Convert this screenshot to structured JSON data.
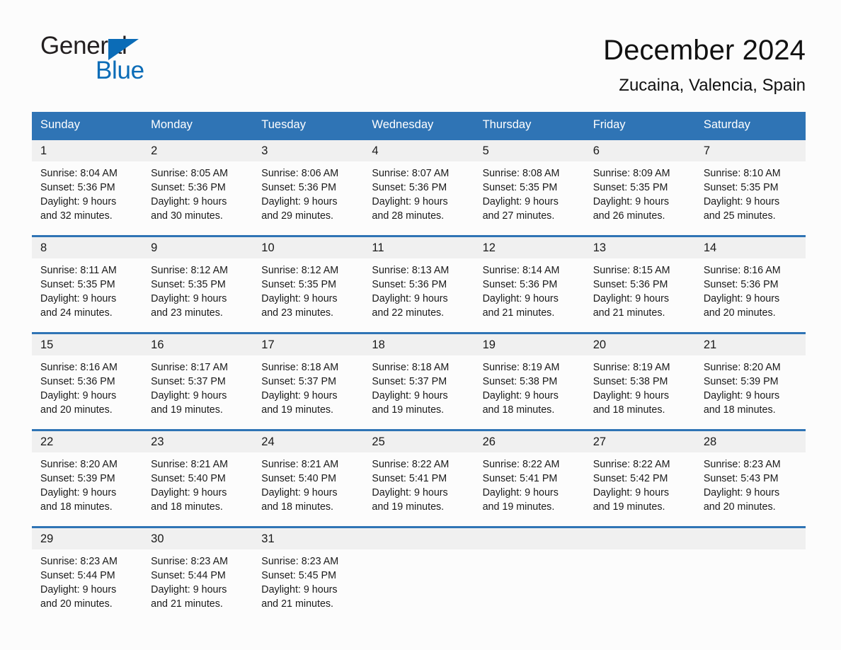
{
  "brand": {
    "name_part1": "General",
    "name_part2": "Blue",
    "triangle_icon": "triangle-icon",
    "accent_color": "#0b6cb7"
  },
  "header": {
    "title": "December 2024",
    "location": "Zucaina, Valencia, Spain"
  },
  "theme": {
    "header_blue": "#2f74b5",
    "daynum_band": "#f0f0f0",
    "page_background": "#fcfcfc",
    "text": "#1a1a1a"
  },
  "calendar": {
    "weekday_headers": [
      "Sunday",
      "Monday",
      "Tuesday",
      "Wednesday",
      "Thursday",
      "Friday",
      "Saturday"
    ],
    "weeks": [
      {
        "days": [
          {
            "num": "1",
            "sunrise": "Sunrise: 8:04 AM",
            "sunset": "Sunset: 5:36 PM",
            "daylight_l1": "Daylight: 9 hours",
            "daylight_l2": "and 32 minutes."
          },
          {
            "num": "2",
            "sunrise": "Sunrise: 8:05 AM",
            "sunset": "Sunset: 5:36 PM",
            "daylight_l1": "Daylight: 9 hours",
            "daylight_l2": "and 30 minutes."
          },
          {
            "num": "3",
            "sunrise": "Sunrise: 8:06 AM",
            "sunset": "Sunset: 5:36 PM",
            "daylight_l1": "Daylight: 9 hours",
            "daylight_l2": "and 29 minutes."
          },
          {
            "num": "4",
            "sunrise": "Sunrise: 8:07 AM",
            "sunset": "Sunset: 5:36 PM",
            "daylight_l1": "Daylight: 9 hours",
            "daylight_l2": "and 28 minutes."
          },
          {
            "num": "5",
            "sunrise": "Sunrise: 8:08 AM",
            "sunset": "Sunset: 5:35 PM",
            "daylight_l1": "Daylight: 9 hours",
            "daylight_l2": "and 27 minutes."
          },
          {
            "num": "6",
            "sunrise": "Sunrise: 8:09 AM",
            "sunset": "Sunset: 5:35 PM",
            "daylight_l1": "Daylight: 9 hours",
            "daylight_l2": "and 26 minutes."
          },
          {
            "num": "7",
            "sunrise": "Sunrise: 8:10 AM",
            "sunset": "Sunset: 5:35 PM",
            "daylight_l1": "Daylight: 9 hours",
            "daylight_l2": "and 25 minutes."
          }
        ]
      },
      {
        "days": [
          {
            "num": "8",
            "sunrise": "Sunrise: 8:11 AM",
            "sunset": "Sunset: 5:35 PM",
            "daylight_l1": "Daylight: 9 hours",
            "daylight_l2": "and 24 minutes."
          },
          {
            "num": "9",
            "sunrise": "Sunrise: 8:12 AM",
            "sunset": "Sunset: 5:35 PM",
            "daylight_l1": "Daylight: 9 hours",
            "daylight_l2": "and 23 minutes."
          },
          {
            "num": "10",
            "sunrise": "Sunrise: 8:12 AM",
            "sunset": "Sunset: 5:35 PM",
            "daylight_l1": "Daylight: 9 hours",
            "daylight_l2": "and 23 minutes."
          },
          {
            "num": "11",
            "sunrise": "Sunrise: 8:13 AM",
            "sunset": "Sunset: 5:36 PM",
            "daylight_l1": "Daylight: 9 hours",
            "daylight_l2": "and 22 minutes."
          },
          {
            "num": "12",
            "sunrise": "Sunrise: 8:14 AM",
            "sunset": "Sunset: 5:36 PM",
            "daylight_l1": "Daylight: 9 hours",
            "daylight_l2": "and 21 minutes."
          },
          {
            "num": "13",
            "sunrise": "Sunrise: 8:15 AM",
            "sunset": "Sunset: 5:36 PM",
            "daylight_l1": "Daylight: 9 hours",
            "daylight_l2": "and 21 minutes."
          },
          {
            "num": "14",
            "sunrise": "Sunrise: 8:16 AM",
            "sunset": "Sunset: 5:36 PM",
            "daylight_l1": "Daylight: 9 hours",
            "daylight_l2": "and 20 minutes."
          }
        ]
      },
      {
        "days": [
          {
            "num": "15",
            "sunrise": "Sunrise: 8:16 AM",
            "sunset": "Sunset: 5:36 PM",
            "daylight_l1": "Daylight: 9 hours",
            "daylight_l2": "and 20 minutes."
          },
          {
            "num": "16",
            "sunrise": "Sunrise: 8:17 AM",
            "sunset": "Sunset: 5:37 PM",
            "daylight_l1": "Daylight: 9 hours",
            "daylight_l2": "and 19 minutes."
          },
          {
            "num": "17",
            "sunrise": "Sunrise: 8:18 AM",
            "sunset": "Sunset: 5:37 PM",
            "daylight_l1": "Daylight: 9 hours",
            "daylight_l2": "and 19 minutes."
          },
          {
            "num": "18",
            "sunrise": "Sunrise: 8:18 AM",
            "sunset": "Sunset: 5:37 PM",
            "daylight_l1": "Daylight: 9 hours",
            "daylight_l2": "and 19 minutes."
          },
          {
            "num": "19",
            "sunrise": "Sunrise: 8:19 AM",
            "sunset": "Sunset: 5:38 PM",
            "daylight_l1": "Daylight: 9 hours",
            "daylight_l2": "and 18 minutes."
          },
          {
            "num": "20",
            "sunrise": "Sunrise: 8:19 AM",
            "sunset": "Sunset: 5:38 PM",
            "daylight_l1": "Daylight: 9 hours",
            "daylight_l2": "and 18 minutes."
          },
          {
            "num": "21",
            "sunrise": "Sunrise: 8:20 AM",
            "sunset": "Sunset: 5:39 PM",
            "daylight_l1": "Daylight: 9 hours",
            "daylight_l2": "and 18 minutes."
          }
        ]
      },
      {
        "days": [
          {
            "num": "22",
            "sunrise": "Sunrise: 8:20 AM",
            "sunset": "Sunset: 5:39 PM",
            "daylight_l1": "Daylight: 9 hours",
            "daylight_l2": "and 18 minutes."
          },
          {
            "num": "23",
            "sunrise": "Sunrise: 8:21 AM",
            "sunset": "Sunset: 5:40 PM",
            "daylight_l1": "Daylight: 9 hours",
            "daylight_l2": "and 18 minutes."
          },
          {
            "num": "24",
            "sunrise": "Sunrise: 8:21 AM",
            "sunset": "Sunset: 5:40 PM",
            "daylight_l1": "Daylight: 9 hours",
            "daylight_l2": "and 18 minutes."
          },
          {
            "num": "25",
            "sunrise": "Sunrise: 8:22 AM",
            "sunset": "Sunset: 5:41 PM",
            "daylight_l1": "Daylight: 9 hours",
            "daylight_l2": "and 19 minutes."
          },
          {
            "num": "26",
            "sunrise": "Sunrise: 8:22 AM",
            "sunset": "Sunset: 5:41 PM",
            "daylight_l1": "Daylight: 9 hours",
            "daylight_l2": "and 19 minutes."
          },
          {
            "num": "27",
            "sunrise": "Sunrise: 8:22 AM",
            "sunset": "Sunset: 5:42 PM",
            "daylight_l1": "Daylight: 9 hours",
            "daylight_l2": "and 19 minutes."
          },
          {
            "num": "28",
            "sunrise": "Sunrise: 8:23 AM",
            "sunset": "Sunset: 5:43 PM",
            "daylight_l1": "Daylight: 9 hours",
            "daylight_l2": "and 20 minutes."
          }
        ]
      },
      {
        "days": [
          {
            "num": "29",
            "sunrise": "Sunrise: 8:23 AM",
            "sunset": "Sunset: 5:44 PM",
            "daylight_l1": "Daylight: 9 hours",
            "daylight_l2": "and 20 minutes."
          },
          {
            "num": "30",
            "sunrise": "Sunrise: 8:23 AM",
            "sunset": "Sunset: 5:44 PM",
            "daylight_l1": "Daylight: 9 hours",
            "daylight_l2": "and 21 minutes."
          },
          {
            "num": "31",
            "sunrise": "Sunrise: 8:23 AM",
            "sunset": "Sunset: 5:45 PM",
            "daylight_l1": "Daylight: 9 hours",
            "daylight_l2": "and 21 minutes."
          },
          {
            "num": "",
            "sunrise": "",
            "sunset": "",
            "daylight_l1": "",
            "daylight_l2": ""
          },
          {
            "num": "",
            "sunrise": "",
            "sunset": "",
            "daylight_l1": "",
            "daylight_l2": ""
          },
          {
            "num": "",
            "sunrise": "",
            "sunset": "",
            "daylight_l1": "",
            "daylight_l2": ""
          },
          {
            "num": "",
            "sunrise": "",
            "sunset": "",
            "daylight_l1": "",
            "daylight_l2": ""
          }
        ]
      }
    ]
  }
}
